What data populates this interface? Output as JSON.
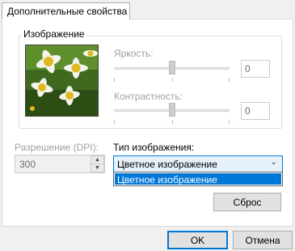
{
  "tab": {
    "label": "Дополнительные свойства"
  },
  "image_group": {
    "legend": "Изображение",
    "brightness": {
      "label": "Яркость:",
      "value": "0",
      "level": 0.5
    },
    "contrast": {
      "label": "Контрастность:",
      "value": "0",
      "level": 0.5
    }
  },
  "resolution": {
    "label": "Разрешение (DPI):",
    "value": "300"
  },
  "image_type": {
    "label": "Тип изображения:",
    "selected": "Цветное изображение",
    "options": [
      "Цветное изображение"
    ]
  },
  "buttons": {
    "reset": "Сброс",
    "ok": "OK",
    "cancel": "Отмена"
  },
  "colors": {
    "accent": "#0078d7",
    "selection": "#0078d7",
    "disabled_text": "#a0a0a0"
  }
}
